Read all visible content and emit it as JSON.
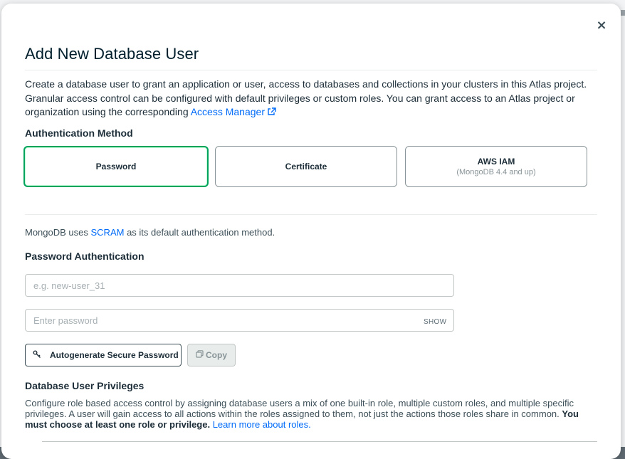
{
  "modal": {
    "title": "Add New Database User",
    "description_main": "Create a database user to grant an application or user, access to databases and collections in your clusters in this Atlas project. Granular access control can be configured with default privileges or custom roles. You can grant access to an Atlas project or organization using the corresponding ",
    "access_manager_link": "Access Manager"
  },
  "auth": {
    "label": "Authentication Method",
    "options": [
      {
        "name": "Password",
        "sub": ""
      },
      {
        "name": "Certificate",
        "sub": ""
      },
      {
        "name": "AWS IAM",
        "sub": "(MongoDB 4.4 and up)"
      }
    ],
    "selected": "Password"
  },
  "scram": {
    "prefix": "MongoDB uses ",
    "link": "SCRAM",
    "suffix": " as its default authentication method."
  },
  "password_auth": {
    "label": "Password Authentication",
    "username_placeholder": "e.g. new-user_31",
    "password_placeholder": "Enter password",
    "show_label": "SHOW",
    "autogen_label": "Autogenerate Secure Password",
    "copy_label": "Copy"
  },
  "privileges": {
    "label": "Database User Privileges",
    "description": "Configure role based access control by assigning database users a mix of one built-in role, multiple custom roles, and multiple specific privileges. A user will gain access to all actions within the roles assigned to them, not just the actions those roles share in common. ",
    "description_bold": "You must choose at least one role or privilege.",
    "learn_more_link": "Learn more about roles."
  },
  "colors": {
    "selected_border": "#00a35c",
    "link": "#016bf8",
    "text": "#1c2d38"
  }
}
